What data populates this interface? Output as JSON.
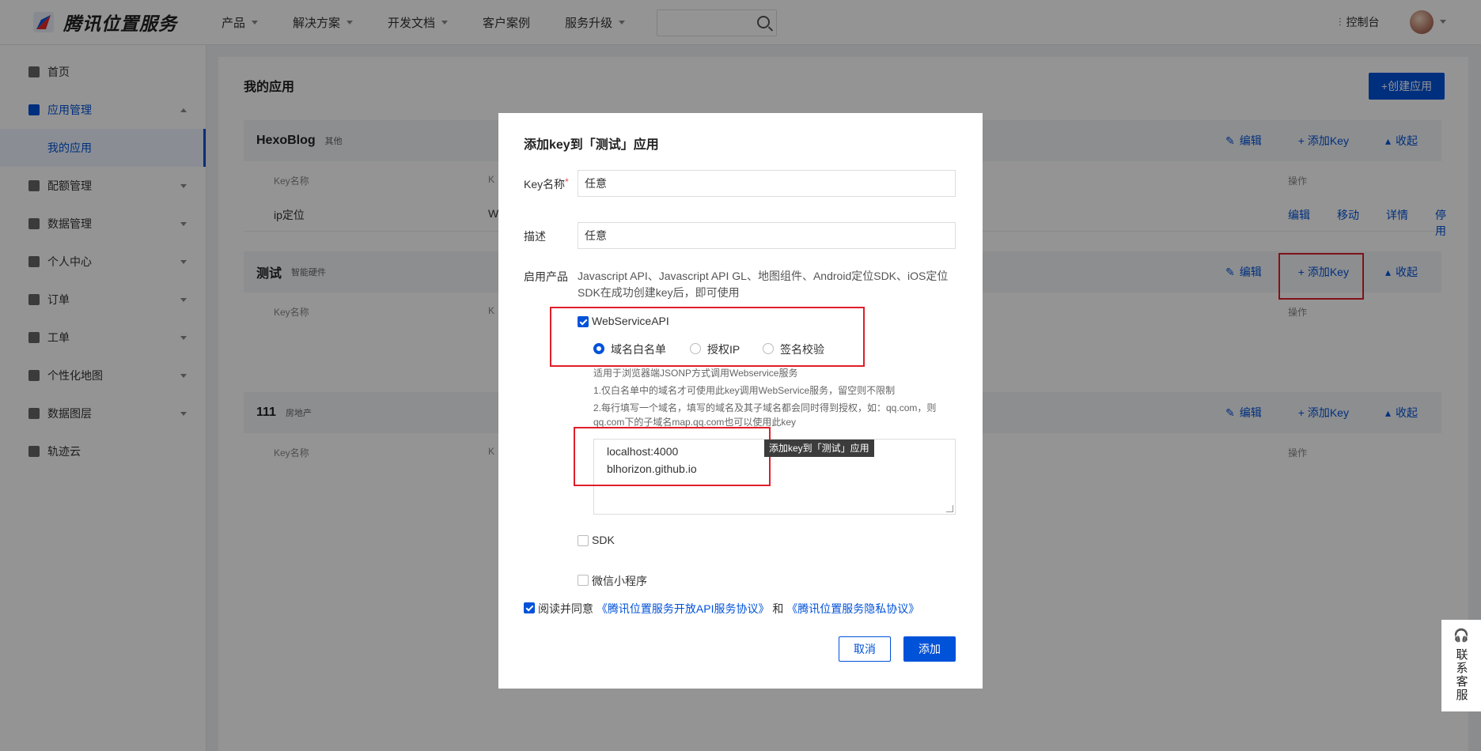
{
  "brand": {
    "name": "腾讯位置服务"
  },
  "nav": [
    "产品",
    "解决方案",
    "开发文档",
    "客户案例",
    "服务升级"
  ],
  "header": {
    "console": "控制台"
  },
  "sidebar": {
    "items": [
      {
        "label": "首页"
      },
      {
        "label": "应用管理"
      },
      {
        "label": "配额管理"
      },
      {
        "label": "数据管理"
      },
      {
        "label": "个人中心"
      },
      {
        "label": "订单"
      },
      {
        "label": "工单"
      },
      {
        "label": "个性化地图"
      },
      {
        "label": "数据图层"
      },
      {
        "label": "轨迹云"
      }
    ],
    "sub_active": "我的应用"
  },
  "main": {
    "title": "我的应用",
    "create_button": "+创建应用",
    "column_key": "Key名称",
    "column_key_short": "K",
    "column_ops": "操作",
    "actions": {
      "edit": "编辑",
      "add_key": "+ 添加Key",
      "collapse": "收起"
    },
    "apps": [
      {
        "name": "HexoBlog",
        "tag": "其他",
        "row": {
          "key": "ip定位",
          "col2": "W",
          "ops": [
            "编辑",
            "移动",
            "详情",
            "停用"
          ]
        }
      },
      {
        "name": "测试",
        "tag": "智能硬件"
      },
      {
        "name": "111",
        "tag": "房地产"
      }
    ]
  },
  "modal": {
    "title": "添加key到「测试」应用",
    "key_label": "Key名称",
    "required_mark": "*",
    "key_value": "任意",
    "desc_label": "描述",
    "desc_value": "任意",
    "product_label": "启用产品",
    "product_desc": "Javascript API、Javascript API GL、地图组件、Android定位SDK、iOS定位SDK在成功创建key后，即可使用",
    "webservice": "WebServiceAPI",
    "radios": [
      "域名白名单",
      "授权IP",
      "签名校验"
    ],
    "hints": [
      "适用于浏览器端JSONP方式调用Webservice服务",
      "1.仅白名单中的域名才可使用此key调用WebService服务，留空则不限制",
      "2.每行填写一个域名，填写的域名及其子域名都会同时得到授权，如：qq.com，则qq.com下的子域名map.qq.com也可以使用此key"
    ],
    "domains": [
      "localhost:4000",
      "blhorizon.github.io"
    ],
    "tooltip": "添加key到「测试」应用",
    "sdk": "SDK",
    "mini_program": "微信小程序",
    "agree_prefix": "阅读并同意",
    "agree_link1": "《腾讯位置服务开放API服务协议》",
    "agree_and": "和",
    "agree_link2": "《腾讯位置服务隐私协议》",
    "cancel": "取消",
    "add": "添加"
  },
  "service": {
    "label": "联系客服"
  }
}
